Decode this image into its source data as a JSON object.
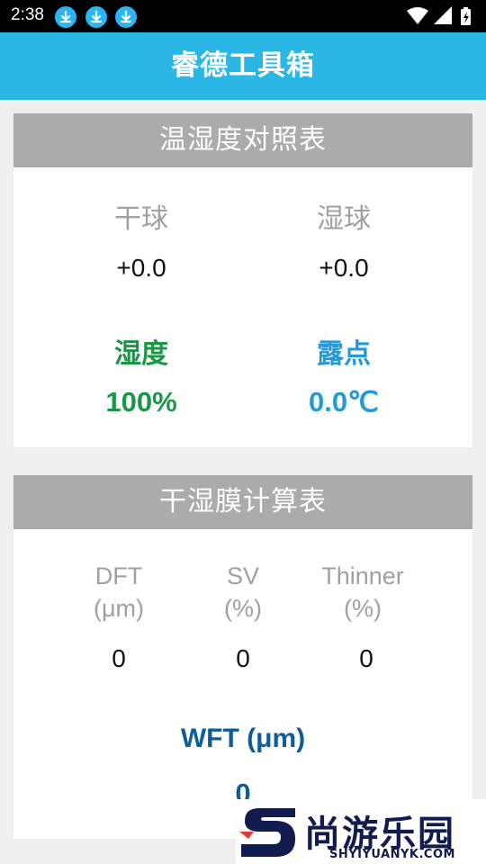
{
  "status_bar": {
    "time": "2:38",
    "icons": [
      "download-icon",
      "download-icon",
      "download-icon",
      "wifi-icon",
      "signal-icon",
      "battery-icon"
    ]
  },
  "app_bar": {
    "title": "睿德工具箱"
  },
  "humidity_card": {
    "header": "温湿度对照表",
    "dry_bulb": {
      "label": "干球",
      "value": "+0.0"
    },
    "wet_bulb": {
      "label": "湿球",
      "value": "+0.0"
    },
    "humidity": {
      "label": "湿度",
      "value": "100%"
    },
    "dew_point": {
      "label": "露点",
      "value": "0.0℃"
    }
  },
  "film_card": {
    "header": "干湿膜计算表",
    "dft": {
      "label_line1": "DFT",
      "label_line2": "(μm)",
      "value": "0"
    },
    "sv": {
      "label_line1": "SV",
      "label_line2": "(%)",
      "value": "0"
    },
    "thinner": {
      "label_line1": "Thinner",
      "label_line2": "(%)",
      "value": "0"
    },
    "wft": {
      "label": "WFT (μm)",
      "value": "0"
    }
  },
  "watermark": {
    "title": "尚游乐园",
    "subtitle": "SHYIYUANYK.COM"
  },
  "colors": {
    "app_bar": "#2ab7e6",
    "card_header": "#ababab",
    "green": "#1a9645",
    "blue": "#2698d6",
    "navy": "#0d5c9c"
  }
}
